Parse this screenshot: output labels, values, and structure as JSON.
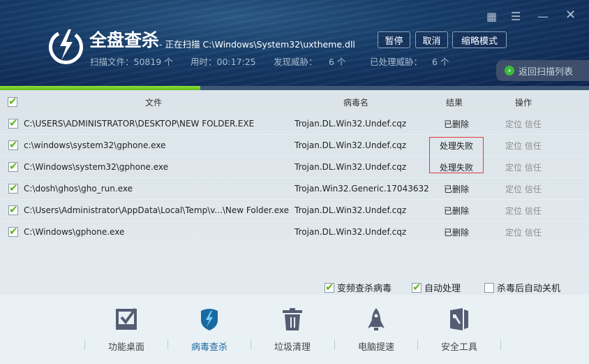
{
  "header": {
    "title": "全盘查杀",
    "scanning": "- 正在扫描 C:\\Windows\\System32\\uxtheme.dll",
    "stats": {
      "files_label": "扫描文件：50819 个",
      "time_label": "用时：00:17:25",
      "found_label": "发现威胁：",
      "found_value": "6 个",
      "handled_label": "已处理威胁：",
      "handled_value": "6 个"
    },
    "buttons": {
      "pause": "暂停",
      "cancel": "取消",
      "mini": "缩略模式"
    },
    "back": "返回扫描列表"
  },
  "progress_percent": 34,
  "table": {
    "columns": [
      "文件",
      "病毒名",
      "结果",
      "操作"
    ],
    "rows": [
      {
        "file": "C:\\USERS\\ADMINISTRATOR\\DESKTOP\\NEW FOLDER.EXE",
        "virus": "Trojan.DL.Win32.Undef.cqz",
        "result": "已删除",
        "locate": "定位",
        "trust": "信任"
      },
      {
        "file": "c:\\windows\\system32\\gphone.exe",
        "virus": "Trojan.DL.Win32.Undef.cqz",
        "result": "处理失败",
        "locate": "定位",
        "trust": "信任"
      },
      {
        "file": "C:\\Windows\\system32\\gphone.exe",
        "virus": "Trojan.DL.Win32.Undef.cqz",
        "result": "处理失败",
        "locate": "定位",
        "trust": "信任"
      },
      {
        "file": "C:\\dosh\\ghos\\gho_run.exe",
        "virus": "Trojan.Win32.Generic.17043632",
        "result": "已删除",
        "locate": "定位",
        "trust": "信任"
      },
      {
        "file": "C:\\Users\\Administrator\\AppData\\Local\\Temp\\v...\\New Folder.exe",
        "virus": "Trojan.DL.Win32.Undef.cqz",
        "result": "已删除",
        "locate": "定位",
        "trust": "信任"
      },
      {
        "file": "C:\\Windows\\gphone.exe",
        "virus": "Trojan.DL.Win32.Undef.cqz",
        "result": "已删除",
        "locate": "定位",
        "trust": "信任"
      }
    ]
  },
  "options": [
    {
      "label": "变频查杀病毒",
      "checked": true
    },
    {
      "label": "自动处理",
      "checked": true
    },
    {
      "label": "杀毒后自动关机",
      "checked": false
    }
  ],
  "nav": [
    {
      "label": "功能桌面"
    },
    {
      "label": "病毒查杀",
      "active": true
    },
    {
      "label": "垃圾清理"
    },
    {
      "label": "电脑提速"
    },
    {
      "label": "安全工具"
    }
  ],
  "colors": {
    "accent": "#1a6aa2",
    "progress": "#7ed12c",
    "fail_box": "#e23a3a"
  }
}
